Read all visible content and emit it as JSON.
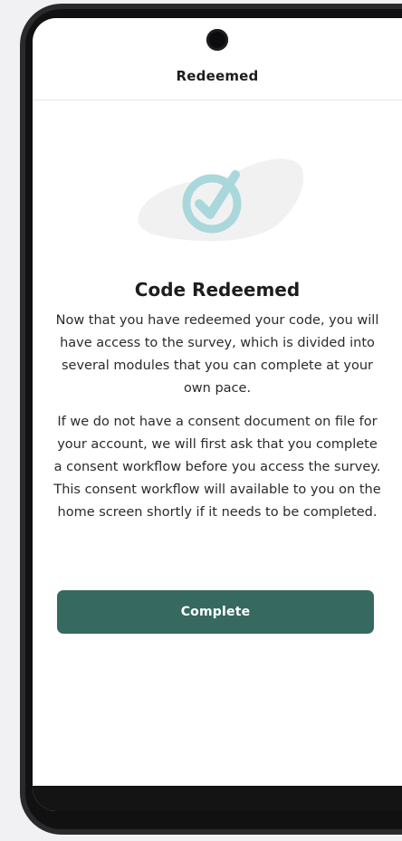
{
  "header": {
    "title": "Redeemed"
  },
  "main": {
    "title": "Code Redeemed",
    "paragraphs": [
      "Now that you have redeemed your code, you will have access to the survey, which is divided into several modules that you can complete at your own pace.",
      "If we do not have a consent document on file for your account, we will first ask that you complete a consent workflow before you access the survey. This consent workflow will available to you on the home screen shortly if it needs to be completed."
    ],
    "complete_button": "Complete"
  },
  "icons": {
    "illustration": "check-circle-icon",
    "camera": "camera-hole"
  },
  "colors": {
    "accent": "#36695f",
    "check": "#a9d7dc",
    "blob": "#f1f1f1",
    "background": "#f1f0f3"
  }
}
